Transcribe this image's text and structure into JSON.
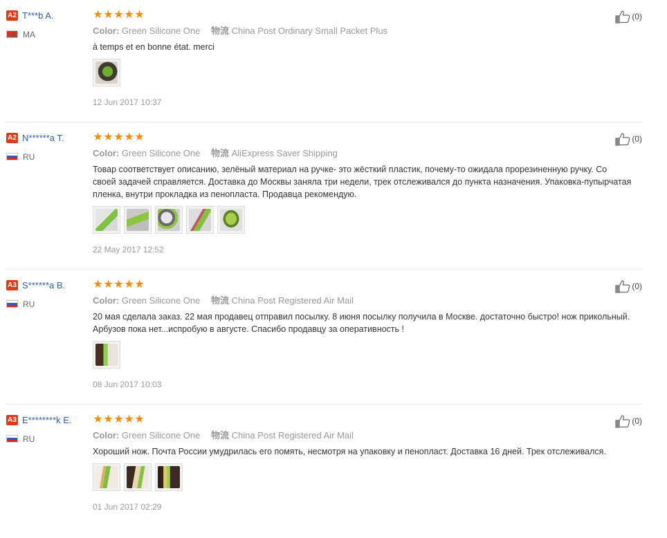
{
  "labels": {
    "color": "Color:",
    "shipping": "物流"
  },
  "reviews": [
    {
      "level": "A2",
      "name": "T***b A.",
      "country": "MA",
      "flag": "ma",
      "stars": [
        "★",
        "★",
        "★",
        "★",
        "★"
      ],
      "color_value": "Green Silicone One",
      "shipping_value": "China Post Ordinary Small Packet Plus",
      "text": "à temps et en bonne état. merci",
      "images": [
        "photo-watermelon-knife"
      ],
      "date": "12 Jun 2017 10:37",
      "likes": "(0)"
    },
    {
      "level": "A2",
      "name": "N******a T.",
      "country": "RU",
      "flag": "ru",
      "stars": [
        "★",
        "★",
        "★",
        "★",
        "★"
      ],
      "color_value": "Green Silicone One",
      "shipping_value": "AliExpress Saver Shipping",
      "text": "Товар соответствует описанию, зелёный материал на ручке- это жёсткий пластик, почему-то ожидала прорезиненную ручку. Со своей задачей справляется. Доставка до Москвы заняла три недели, трек отслеживался до пункта назначения. Упаковка-пупырчатая пленка, внутри прокладка из пенопласта. Продавца рекомендую.",
      "images": [
        "photo-1",
        "photo-2",
        "photo-3",
        "photo-4",
        "photo-5"
      ],
      "date": "22 May 2017 12:52",
      "likes": "(0)"
    },
    {
      "level": "A3",
      "name": "S******a B.",
      "country": "RU",
      "flag": "ru",
      "stars": [
        "★",
        "★",
        "★",
        "★",
        "★"
      ],
      "color_value": "Green Silicone One",
      "shipping_value": "China Post Registered Air Mail",
      "text": "20 мая сделала заказ. 22 мая продавец отправил посылку. 8 июня посылку получила в Москве. достаточно быстро! нож прикольный. Арбузов пока нет...испробую в августе. Спасибо продавцу за оперативность !",
      "images": [
        "photo-1"
      ],
      "date": "08 Jun 2017 10:03",
      "likes": "(0)"
    },
    {
      "level": "A3",
      "name": "E********k E.",
      "country": "RU",
      "flag": "ru",
      "stars": [
        "★",
        "★",
        "★",
        "★",
        "★"
      ],
      "color_value": "Green Silicone One",
      "shipping_value": "China Post Registered Air Mail",
      "text": "Хороший нож. Почта России умудрилась его помять, несмотря на упаковку и пенопласт. Доставка 16 дней. Трек отслеживался.",
      "images": [
        "photo-1",
        "photo-2",
        "photo-3"
      ],
      "date": "01 Jun 2017 02:29",
      "likes": "(0)"
    }
  ]
}
